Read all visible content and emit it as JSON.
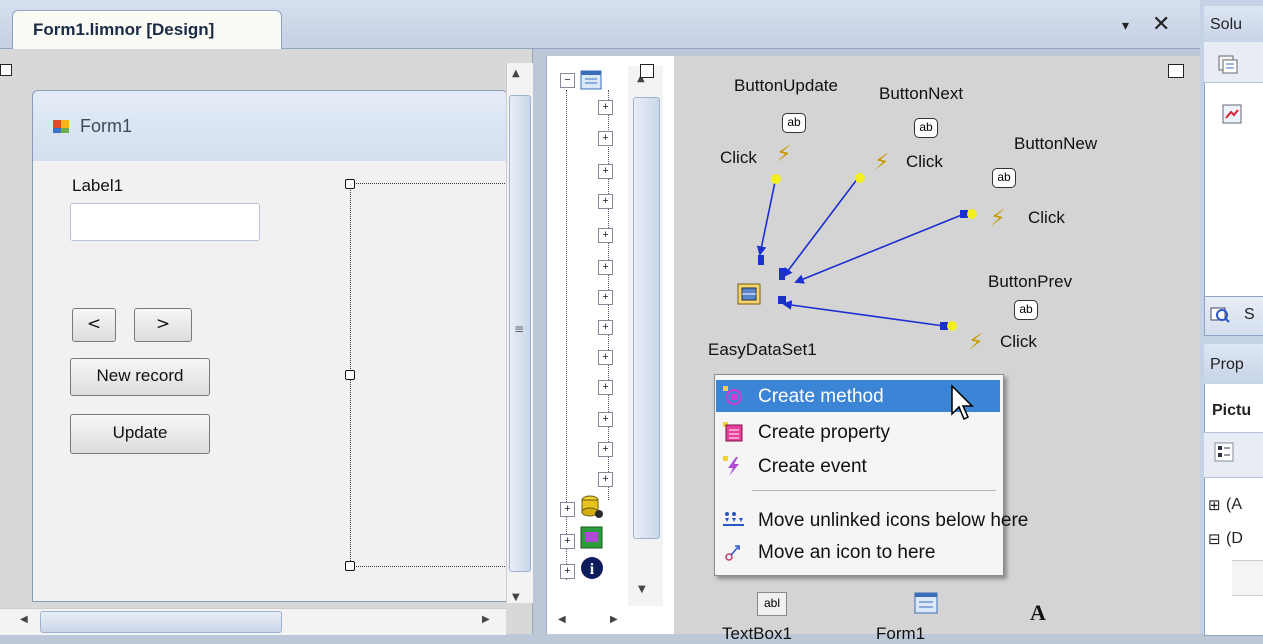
{
  "document_tab": {
    "title": "Form1.limnor [Design]",
    "dropdown_glyph": "▾",
    "close_glyph": "✕"
  },
  "form": {
    "title": "Form1",
    "label1": "Label1",
    "prev_button": "<",
    "next_button": ">",
    "new_record_button": "New record",
    "update_button": "Update"
  },
  "graph": {
    "nodes": [
      {
        "id": "button-update",
        "name": "ButtonUpdate",
        "event": "Click",
        "icon": "ab"
      },
      {
        "id": "button-next",
        "name": "ButtonNext",
        "event": "Click",
        "icon": "ab"
      },
      {
        "id": "button-new",
        "name": "ButtonNew",
        "event": "Click",
        "icon": "ab"
      },
      {
        "id": "button-prev",
        "name": "ButtonPrev",
        "event": "Click",
        "icon": "ab"
      }
    ],
    "dataset": "EasyDataSet1",
    "bottom_items": [
      {
        "name": "TextBox1",
        "icon": "abl"
      },
      {
        "name": "Form1",
        "icon": "form-icon"
      },
      {
        "name": "",
        "icon": "A"
      }
    ]
  },
  "context_menu": {
    "items": [
      {
        "label": "Create method",
        "icon": "method-icon",
        "selected": true
      },
      {
        "label": "Create property",
        "icon": "property-icon",
        "selected": false
      },
      {
        "label": "Create event",
        "icon": "event-icon",
        "selected": false
      },
      {
        "label": "Move unlinked icons below here",
        "icon": "move-unlinked-icon",
        "selected": false
      },
      {
        "label": "Move an icon to here",
        "icon": "move-icon",
        "selected": false
      }
    ]
  },
  "right_panel": {
    "solution_header": "Solu",
    "search_label": "S",
    "properties_header": "Prop",
    "picture_label": "Pictu",
    "row_a": "(A",
    "row_d": "(D",
    "expand_glyph": "⊞",
    "collapse_glyph": "⊟"
  },
  "colors": {
    "selection": "#3c84d6",
    "link_arrow": "#1a2fd1",
    "port": "#f4f020"
  }
}
